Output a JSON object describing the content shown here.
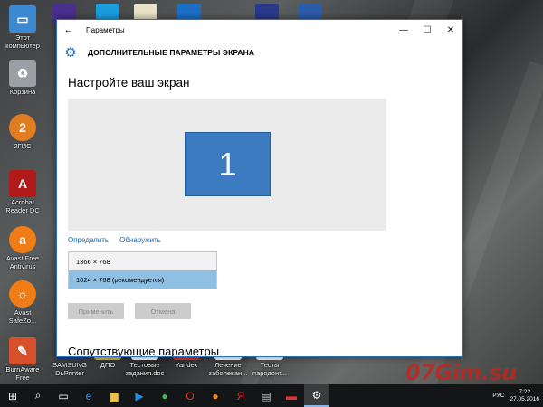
{
  "window": {
    "title": "Параметры",
    "header": "ДОПОЛНИТЕЛЬНЫЕ ПАРАМЕТРЫ ЭКРАНА",
    "heading": "Настройте ваш экран",
    "display_number": "1",
    "identify_link": "Определить",
    "detect_link": "Обнаружить",
    "resolution_options": [
      "1366 × 768",
      "1024 × 768 (рекомендуется)"
    ],
    "selected_resolution": "1024 × 768 (рекомендуется)",
    "apply_button": "Применить",
    "cancel_button": "Отмена",
    "related_heading": "Сопутствующие параметры"
  },
  "desktop_icons": [
    {
      "label": "Этот\nкомпьютер",
      "icon": "computer-icon",
      "color": "#3b89d0"
    },
    {
      "label": "Корзина",
      "icon": "recycle-bin-icon",
      "color": "#9aa0a6"
    },
    {
      "label": "2ГИС",
      "icon": "2gis-icon",
      "color": "#e07d21"
    },
    {
      "label": "Acrobat\nReader DC",
      "icon": "acrobat-icon",
      "color": "#b21a1a"
    },
    {
      "label": "Avast Free\nAntivirus",
      "icon": "avast-icon",
      "color": "#f07c16"
    },
    {
      "label": "Avast\nSafeZo...",
      "icon": "avast-safezone-icon",
      "color": "#f07c16"
    },
    {
      "label": "BurnAware\nFree",
      "icon": "burnaware-icon",
      "color": "#d6502a"
    }
  ],
  "bottom_desktop_labels": [
    "SAMSUNG\nDr.Printer",
    "ДПО",
    "Тестовые\nзадания.doc",
    "Yandex",
    "Лечение\nзаболеван...",
    "Тесты\nпародонт..."
  ],
  "watermark": "07Gim.su",
  "taskbar": {
    "items": [
      "start-icon",
      "search-icon",
      "task-view-icon",
      "edge-icon",
      "explorer-icon",
      "media-player-icon",
      "chrome-icon",
      "opera-icon",
      "firefox-icon",
      "yandex-icon",
      "printer-icon",
      "app-icon",
      "settings-icon"
    ],
    "language": "РУС",
    "time": "7:22",
    "date": "27.05.2016"
  }
}
